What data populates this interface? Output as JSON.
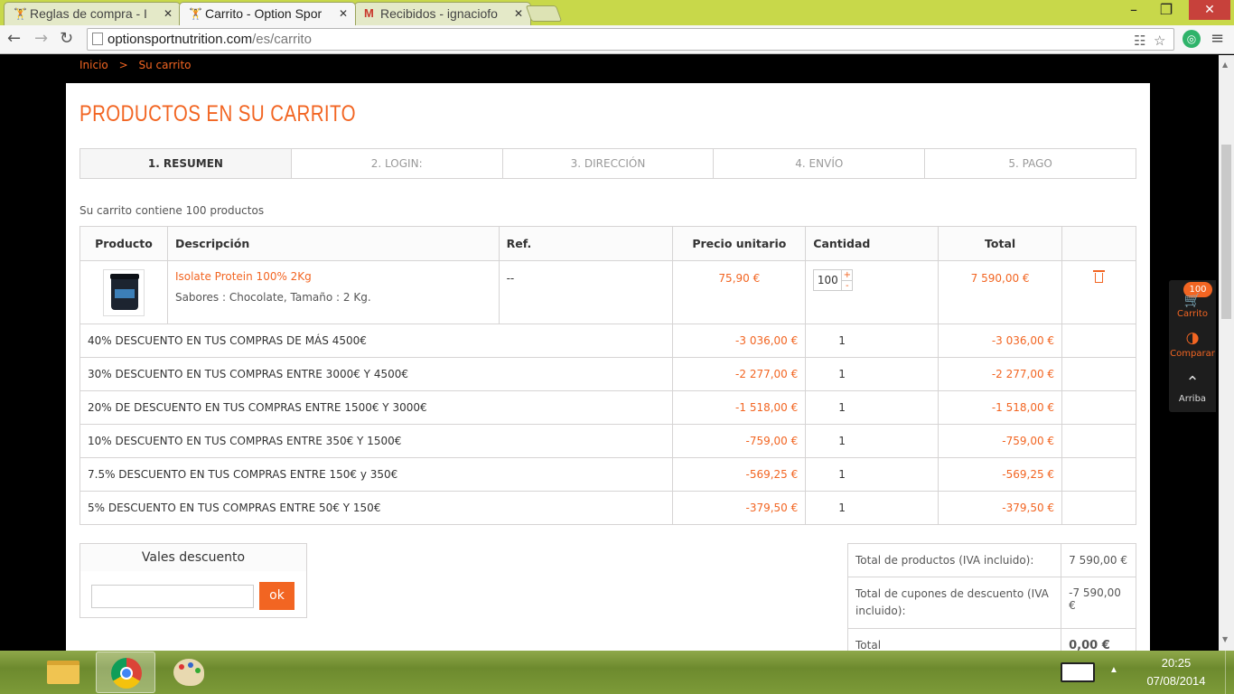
{
  "browser": {
    "tabs": [
      {
        "title": "Reglas de compra - I",
        "active": false,
        "icon": "option-favicon"
      },
      {
        "title": "Carrito - Option Spor",
        "active": true,
        "icon": "option-favicon"
      },
      {
        "title": "Recibidos - ignaciofo",
        "active": false,
        "icon": "gmail-icon"
      }
    ],
    "tab_close": "✕",
    "url_host": "optionsportnutrition.com",
    "url_path": "/es/carrito"
  },
  "breadcrumb": {
    "home": "Inicio",
    "separator": ">",
    "current": "Su carrito"
  },
  "heading": "PRODUCTOS EN SU CARRITO",
  "steps": [
    {
      "label": "1. RESUMEN",
      "current": true
    },
    {
      "label": "2. LOGIN:",
      "current": false
    },
    {
      "label": "3. DIRECCIÓN",
      "current": false
    },
    {
      "label": "4. ENVÍO",
      "current": false
    },
    {
      "label": "5. PAGO",
      "current": false
    }
  ],
  "summary": "Su carrito contiene 100 productos",
  "table": {
    "headers": {
      "product": "Producto",
      "description": "Descripción",
      "ref": "Ref.",
      "unit_price": "Precio unitario",
      "quantity": "Cantidad",
      "total": "Total"
    },
    "item": {
      "name": "Isolate Protein 100% 2Kg",
      "attributes": "Sabores : Chocolate, Tamaño : 2 Kg.",
      "ref": "--",
      "unit_price": "75,90 €",
      "quantity": "100",
      "qty_plus": "+",
      "qty_minus": "-",
      "total": "7 590,00 €"
    },
    "discounts": [
      {
        "label": "40% DESCUENTO EN TUS COMPRAS DE MÁS 4500€",
        "price": "-3 036,00 €",
        "qty": "1",
        "total": "-3 036,00 €"
      },
      {
        "label": "30% DESCUENTO EN TUS COMPRAS ENTRE 3000€ Y 4500€",
        "price": "-2 277,00 €",
        "qty": "1",
        "total": "-2 277,00 €"
      },
      {
        "label": "20% DE DESCUENTO EN TUS COMPRAS ENTRE 1500€ Y 3000€",
        "price": "-1 518,00 €",
        "qty": "1",
        "total": "-1 518,00 €"
      },
      {
        "label": "10% DESCUENTO EN TUS COMPRAS ENTRE 350€ Y 1500€",
        "price": "-759,00 €",
        "qty": "1",
        "total": "-759,00 €"
      },
      {
        "label": "7.5% DESCUENTO EN TUS COMPRAS ENTRE 150€ y 350€",
        "price": "-569,25 €",
        "qty": "1",
        "total": "-569,25 €"
      },
      {
        "label": "5% DESCUENTO EN TUS COMPRAS ENTRE 50€ Y 150€",
        "price": "-379,50 €",
        "qty": "1",
        "total": "-379,50 €"
      }
    ]
  },
  "vouchers": {
    "title": "Vales descuento",
    "input_value": "",
    "button": "ok"
  },
  "totals": [
    {
      "label": "Total de productos (IVA incluido):",
      "value": "7 590,00 €"
    },
    {
      "label": "Total de cupones de descuento (IVA incluido):",
      "value": "-7 590,00 €"
    },
    {
      "label": "Total",
      "value": "0,00 €"
    }
  ],
  "side_widget": {
    "cart_count": "100",
    "cart_label": "Carrito",
    "compare_label": "Comparar",
    "top_label": "Arriba"
  },
  "taskbar": {
    "time": "20:25",
    "date": "07/08/2014"
  },
  "colors": {
    "accent": "#f26522",
    "taskbar": "#7c9a38",
    "tabbar": "#c8d84a"
  }
}
